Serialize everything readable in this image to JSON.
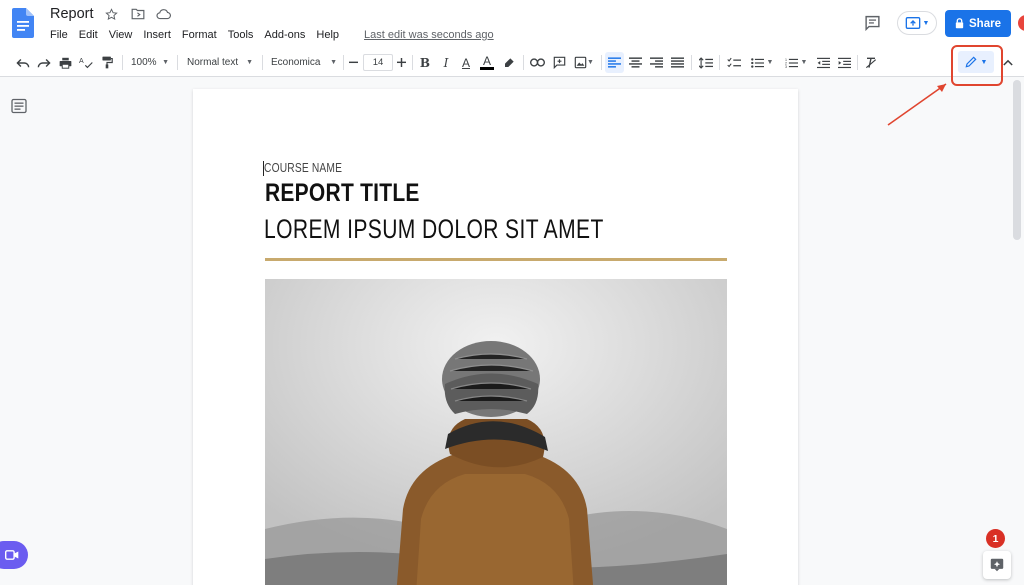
{
  "document": {
    "title": "Report",
    "last_edit": "Last edit was seconds ago"
  },
  "menu": {
    "items": [
      "File",
      "Edit",
      "View",
      "Insert",
      "Format",
      "Tools",
      "Add-ons",
      "Help"
    ]
  },
  "header": {
    "share_label": "Share",
    "icons": [
      "star-icon",
      "move-to-folder-icon",
      "cloud-saved-icon",
      "comment-history-icon",
      "present-icon",
      "lock-icon"
    ]
  },
  "toolbar": {
    "zoom": "100%",
    "style": "Normal text",
    "font": "Economica",
    "font_size": "14",
    "bold": "B",
    "italic": "I",
    "underline": "A",
    "active_alignment": "left",
    "mode": "Editing"
  },
  "content": {
    "course_name": "COURSE NAME",
    "report_title": "REPORT TITLE",
    "subtitle": "LOREM IPSUM DOLOR SIT AMET"
  },
  "notifications": {
    "count": "1"
  },
  "colors": {
    "share_blue": "#1a73e8",
    "rule_gold": "#c8aa6e",
    "annotation_red": "#e0452f",
    "meet_purple": "#6b5cf0",
    "badge_red": "#d93025"
  }
}
